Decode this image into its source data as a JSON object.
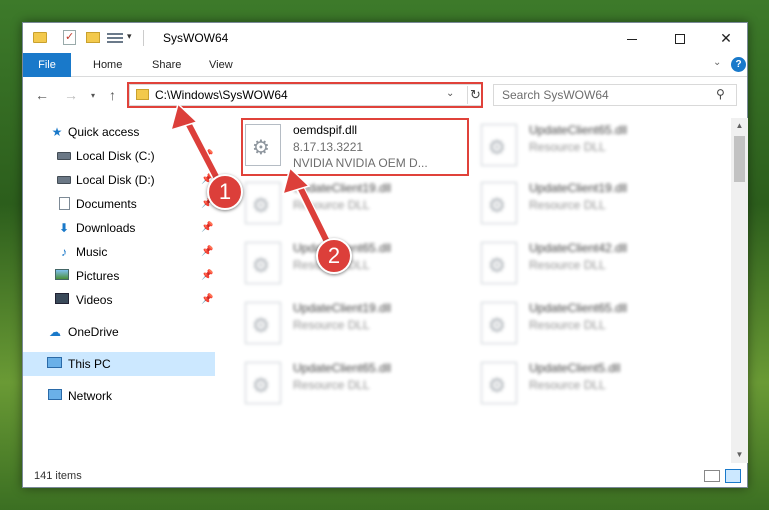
{
  "window": {
    "title": "SysWOW64",
    "controls": {
      "minimize": "minimize",
      "maximize": "maximize",
      "close": "✕"
    }
  },
  "ribbon": {
    "tabs": [
      "File",
      "Home",
      "Share",
      "View"
    ],
    "help": "?"
  },
  "nav": {
    "address": "C:\\Windows\\SysWOW64",
    "search_placeholder": "Search SysWOW64"
  },
  "sidebar": {
    "items": [
      {
        "label": "Quick access",
        "icon": "star-icon"
      },
      {
        "label": "Local Disk (C:)",
        "icon": "disk-icon",
        "pinned": true
      },
      {
        "label": "Local Disk (D:)",
        "icon": "disk-icon",
        "pinned": true
      },
      {
        "label": "Documents",
        "icon": "documents-icon",
        "pinned": true
      },
      {
        "label": "Downloads",
        "icon": "download-icon",
        "pinned": true
      },
      {
        "label": "Music",
        "icon": "music-icon",
        "pinned": true
      },
      {
        "label": "Pictures",
        "icon": "pictures-icon",
        "pinned": true
      },
      {
        "label": "Videos",
        "icon": "videos-icon",
        "pinned": true
      },
      {
        "label": "OneDrive",
        "icon": "onedrive-icon"
      },
      {
        "label": "This PC",
        "icon": "computer-icon",
        "selected": true
      },
      {
        "label": "Network",
        "icon": "network-icon"
      }
    ]
  },
  "files": [
    {
      "name": "oemdspif.dll",
      "version": "8.17.13.3221",
      "description": "NVIDIA NVIDIA OEM D...",
      "highlighted": true
    },
    {
      "name": "UpdateClient65.dll",
      "description": "Resource DLL"
    },
    {
      "name": "UpdateClient19.dll",
      "description": "Resource DLL"
    },
    {
      "name": "UpdateClient19.dll",
      "description": "Resource DLL"
    },
    {
      "name": "UpdateClient65.dll",
      "description": "Resource DLL"
    },
    {
      "name": "UpdateClient42.dll",
      "description": "Resource DLL"
    },
    {
      "name": "UpdateClient19.dll",
      "description": "Resource DLL"
    },
    {
      "name": "UpdateClient65.dll",
      "description": "Resource DLL"
    },
    {
      "name": "UpdateClient65.dll",
      "description": "Resource DLL"
    },
    {
      "name": "UpdateClient5.dll",
      "description": "Resource DLL"
    }
  ],
  "status": {
    "item_count": "141 items"
  },
  "annotations": {
    "badge1": "1",
    "badge2": "2",
    "color": "#dc3f3a"
  }
}
